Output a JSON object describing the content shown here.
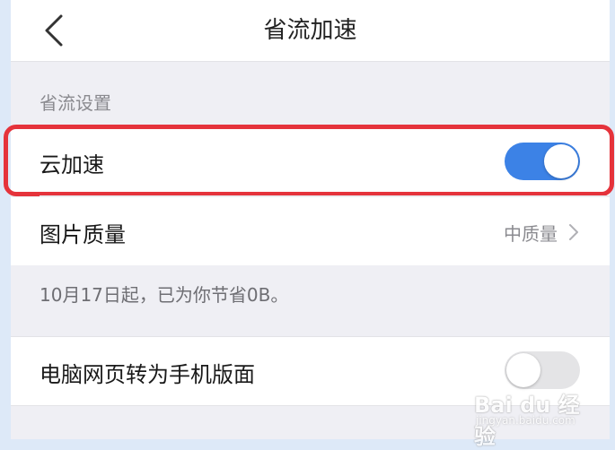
{
  "navbar": {
    "title": "省流加速",
    "back_icon": "chevron-left-icon"
  },
  "section": {
    "header": "省流设置"
  },
  "cloud_accel": {
    "label": "云加速",
    "toggle_on": true
  },
  "image_quality": {
    "label": "图片质量",
    "value": "中质量",
    "icon": "chevron-right-icon"
  },
  "saving_note": "10月17日起，已为你节省0B。",
  "pc_to_mobile": {
    "label": "电脑网页转为手机版面",
    "toggle_on": false
  },
  "watermark": {
    "brand": "Bai du 经验",
    "sub": "jingyan.baidu.com"
  },
  "colors": {
    "accent": "#3c82e6",
    "highlight": "#e5333b",
    "background": "#efeff4"
  }
}
